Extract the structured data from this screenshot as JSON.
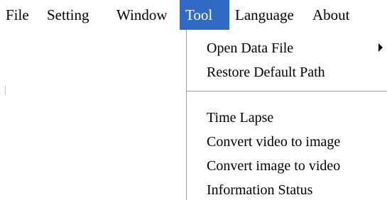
{
  "menubar": {
    "items": [
      {
        "label": "File"
      },
      {
        "label": "Setting"
      },
      {
        "label": "Window"
      },
      {
        "label": "Tool",
        "active": true
      },
      {
        "label": "Language"
      },
      {
        "label": "About"
      }
    ]
  },
  "tool_menu": {
    "items": [
      {
        "label": "Open Data File",
        "has_submenu": true
      },
      {
        "label": "Restore Default Path"
      },
      {
        "label": "Time Lapse"
      },
      {
        "label": "Convert video to image"
      },
      {
        "label": "Convert image to video"
      },
      {
        "label": "Information Status"
      }
    ]
  },
  "colors": {
    "active_menu_bg": "#316ac5",
    "active_menu_text": "#ffffff",
    "background": "#ffffff",
    "separator": "#a0a0a0"
  }
}
